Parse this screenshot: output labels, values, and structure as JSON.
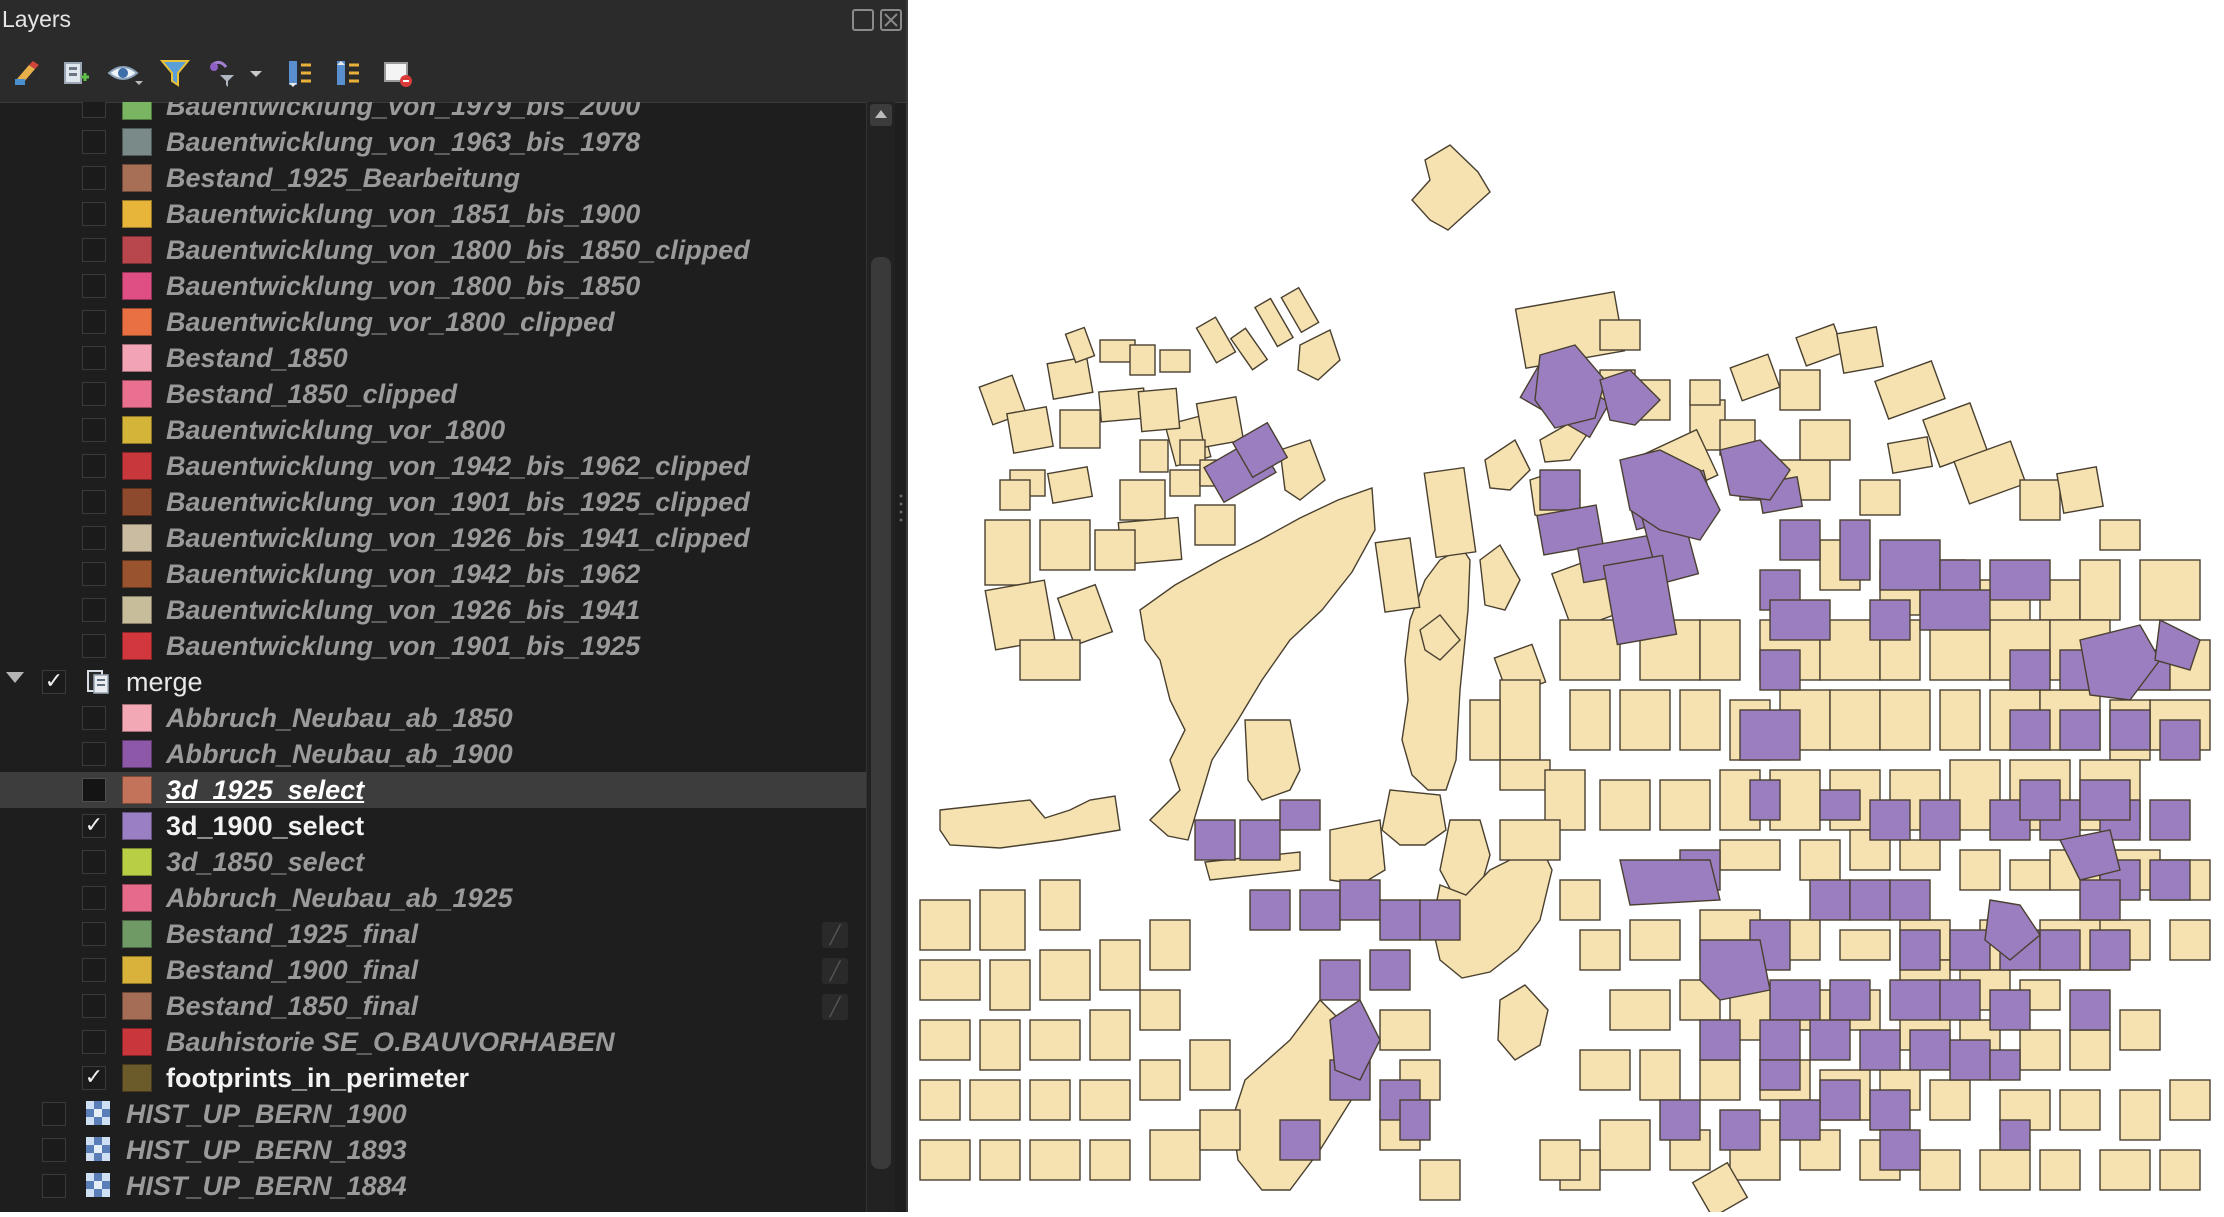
{
  "panel": {
    "title": "Layers",
    "toolbar": [
      {
        "icon": "style-brush-icon"
      },
      {
        "icon": "add-group-icon"
      },
      {
        "icon": "eye-visibility-icon"
      },
      {
        "icon": "filter-funnel-icon"
      },
      {
        "icon": "expression-filter-icon"
      },
      {
        "icon": "expand-all-icon"
      },
      {
        "icon": "collapse-all-icon"
      },
      {
        "icon": "remove-layer-icon"
      }
    ]
  },
  "layers": [
    {
      "label": "Bauentwicklung_von_1979_bis_2000",
      "color": "#7ab661",
      "checked": false,
      "style": "dim",
      "partial": true
    },
    {
      "label": "Bauentwicklung_von_1963_bis_1978",
      "color": "#7a8a88",
      "checked": false,
      "style": "dim"
    },
    {
      "label": "Bestand_1925_Bearbeitung",
      "color": "#a86f57",
      "checked": false,
      "style": "dim"
    },
    {
      "label": "Bauentwicklung_von_1851_bis_1900",
      "color": "#e6b53a",
      "checked": false,
      "style": "dim"
    },
    {
      "label": "Bauentwicklung_von_1800_bis_1850_clipped",
      "color": "#b8474d",
      "checked": false,
      "style": "dim"
    },
    {
      "label": "Bauentwicklung_von_1800_bis_1850",
      "color": "#df4f84",
      "checked": false,
      "style": "dim"
    },
    {
      "label": "Bauentwicklung_vor_1800_clipped",
      "color": "#e87042",
      "checked": false,
      "style": "dim"
    },
    {
      "label": "Bestand_1850",
      "color": "#f2a3b4",
      "checked": false,
      "style": "dim"
    },
    {
      "label": "Bestand_1850_clipped",
      "color": "#e9708f",
      "checked": false,
      "style": "dim"
    },
    {
      "label": "Bauentwicklung_vor_1800",
      "color": "#d5b43a",
      "checked": false,
      "style": "dim"
    },
    {
      "label": "Bauentwicklung_von_1942_bis_1962_clipped",
      "color": "#c8373b",
      "checked": false,
      "style": "dim"
    },
    {
      "label": "Bauentwicklung_von_1901_bis_1925_clipped",
      "color": "#8e4a2c",
      "checked": false,
      "style": "dim"
    },
    {
      "label": "Bauentwicklung_von_1926_bis_1941_clipped",
      "color": "#c9bca0",
      "checked": false,
      "style": "dim"
    },
    {
      "label": "Bauentwicklung_von_1942_bis_1962",
      "color": "#99532f",
      "checked": false,
      "style": "dim"
    },
    {
      "label": "Bauentwicklung_von_1926_bis_1941",
      "color": "#c8bd9b",
      "checked": false,
      "style": "dim"
    },
    {
      "label": "Bauentwicklung_von_1901_bis_1925",
      "color": "#d2373d",
      "checked": false,
      "style": "dim"
    },
    {
      "label": "merge",
      "type": "group",
      "checked": true,
      "style": "grp"
    },
    {
      "label": "Abbruch_Neubau_ab_1850",
      "color": "#f3a8b6",
      "checked": false,
      "style": "dim"
    },
    {
      "label": "Abbruch_Neubau_ab_1900",
      "color": "#8e58a8",
      "checked": false,
      "style": "dim"
    },
    {
      "label": "3d_1925_select",
      "color": "#c2735a",
      "checked": false,
      "style": "selected"
    },
    {
      "label": "3d_1900_select",
      "color": "#9a7fc4",
      "checked": true,
      "style": "vis"
    },
    {
      "label": "3d_1850_select",
      "color": "#b8cf45",
      "checked": false,
      "style": "dim"
    },
    {
      "label": "Abbruch_Neubau_ab_1925",
      "color": "#e66a8a",
      "checked": false,
      "style": "dim"
    },
    {
      "label": "Bestand_1925_final",
      "color": "#6f9a66",
      "checked": false,
      "style": "dim",
      "filter": true
    },
    {
      "label": "Bestand_1900_final",
      "color": "#d8b23a",
      "checked": false,
      "style": "dim",
      "filter": true
    },
    {
      "label": "Bestand_1850_final",
      "color": "#a56d56",
      "checked": false,
      "style": "dim",
      "filter": true
    },
    {
      "label": "Bauhistorie SE_O.BAUVORHABEN",
      "color": "#c9373c",
      "checked": false,
      "style": "dim"
    },
    {
      "label": "footprints_in_perimeter",
      "color": "#6b5a2a",
      "checked": true,
      "style": "vis"
    },
    {
      "label": "HIST_UP_BERN_1900",
      "type": "raster",
      "checked": false,
      "style": "dim"
    },
    {
      "label": "HIST_UP_BERN_1893",
      "type": "raster",
      "checked": false,
      "style": "dim"
    },
    {
      "label": "HIST_UP_BERN_1884",
      "type": "raster",
      "checked": false,
      "style": "dim"
    }
  ],
  "map": {
    "fill_footprints": "#f5e2b0",
    "fill_selected": "#9a7ec0",
    "stroke": "#4a4030"
  }
}
